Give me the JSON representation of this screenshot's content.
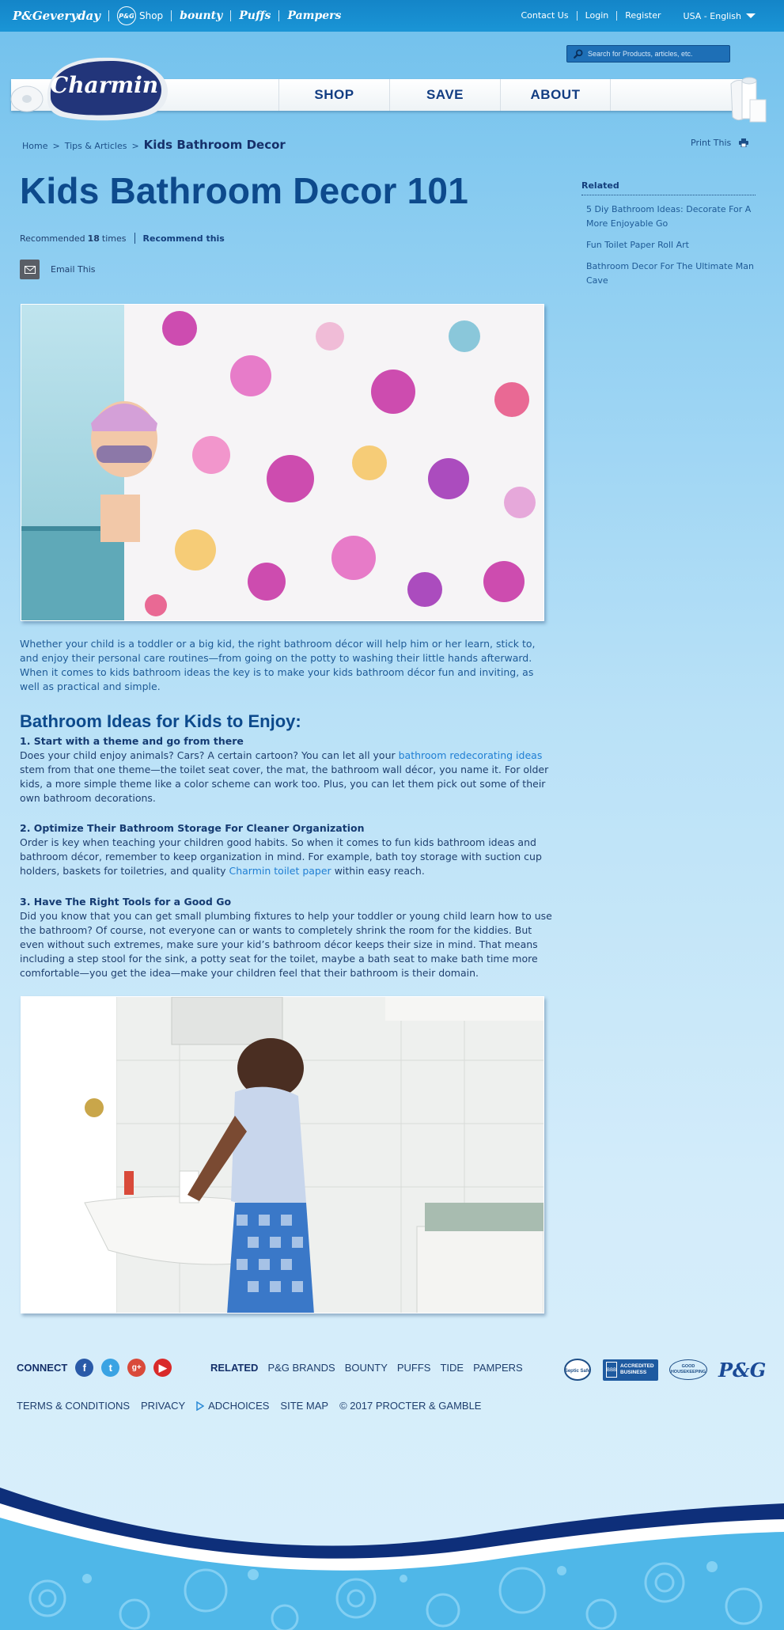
{
  "topbar": {
    "brands": [
      "P&Geveryday",
      "Shop",
      "bounty",
      "Puffs",
      "Pampers"
    ],
    "pg_badge": "P&G",
    "links": [
      "Contact Us",
      "Login",
      "Register"
    ],
    "locale": "USA - English"
  },
  "search": {
    "placeholder": "Search for Products, articles, etc."
  },
  "logo": {
    "text": "Charmin"
  },
  "nav": {
    "items": [
      "SHOP",
      "SAVE",
      "ABOUT"
    ]
  },
  "breadcrumb": {
    "home": "Home",
    "section": "Tips & Articles",
    "current": "Kids Bathroom Decor",
    "separator": ">"
  },
  "print": {
    "label": "Print This"
  },
  "article": {
    "title": "Kids Bathroom Decor 101",
    "recommended_prefix": "Recommended",
    "recommended_count": "18",
    "recommended_suffix": "times",
    "recommend_action": "Recommend this",
    "email_label": "Email This",
    "intro": "Whether your child is a toddler or a big kid, the right bathroom décor will help him or her learn, stick to, and enjoy their personal care routines—from going on the potty to washing their little hands afterward. When it comes to kids bathroom ideas the key is to make your kids bathroom décor fun and inviting, as well as practical and simple.",
    "section_title": "Bathroom Ideas for Kids to Enjoy:",
    "items": [
      {
        "title": "1. Start with a theme and go from there",
        "text_before": "Does your child enjoy animals? Cars? A certain cartoon? You can let all your",
        "link": "bathroom redecorating ideas",
        "text_after": "stem from that one theme—the toilet seat cover, the mat, the bathroom wall décor, you name it. For older kids, a more simple theme like a color scheme can work too. Plus, you can let them pick out some of their own bathroom decorations."
      },
      {
        "title": "2. Optimize Their Bathroom Storage For Cleaner Organization",
        "text_before": "Order is key when teaching your children good habits. So when it comes to fun kids bathroom ideas and bathroom décor, remember to keep organization in mind. For example, bath toy storage with suction cup holders, baskets for toiletries, and quality",
        "link": "Charmin toilet paper",
        "text_after": "within easy reach."
      },
      {
        "title": "3. Have The Right Tools for a Good Go",
        "text": "Did you know that you can get small plumbing fixtures to help your toddler or young child learn how to use the bathroom? Of course, not everyone can or wants to completely shrink the room for the kiddies. But even without such extremes, make sure your kid’s bathroom décor keeps their size in mind. That means including a step stool for the sink, a potty seat for the toilet, maybe a bath seat to make bath time more comfortable—you get the idea—make your children feel that their bathroom is their domain."
      }
    ]
  },
  "related": {
    "heading": "Related",
    "items": [
      "5 Diy Bathroom Ideas: Decorate For A More Enjoyable Go",
      "Fun Toilet Paper Roll Art",
      "Bathroom Decor For The Ultimate Man Cave"
    ]
  },
  "footer": {
    "connect": "CONNECT",
    "social": [
      "f",
      "t",
      "g+",
      "▶"
    ],
    "related_label": "RELATED",
    "related_links": [
      "P&G BRANDS",
      "BOUNTY",
      "PUFFS",
      "TIDE",
      "PAMPERS"
    ],
    "legal": [
      "TERMS & CONDITIONS",
      "PRIVACY",
      "ADCHOICES",
      "SITE MAP",
      "© 2017 PROCTER & GAMBLE"
    ],
    "badges": {
      "septic": "Septic Safe",
      "bbb_mark": "BBB",
      "bbb": "ACCREDITED BUSINESS",
      "gh": "GOOD HOUSEKEEPING",
      "pg": "P&G"
    }
  },
  "colors": {
    "accent": "#0d4a8c",
    "link": "#1f7ed3",
    "topbar": "#1485c8",
    "nav_text": "#123d82"
  }
}
